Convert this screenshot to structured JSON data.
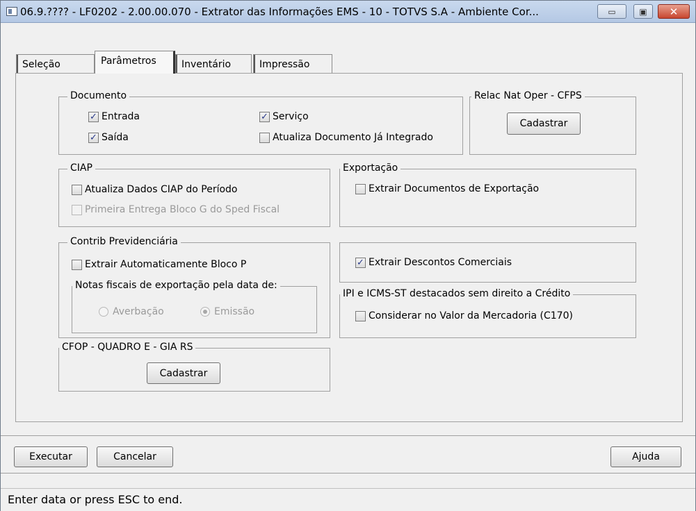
{
  "window": {
    "title": "06.9.???? - LF0202 - 2.00.00.070 - Extrator das Informações EMS - 10 - TOTVS S.A - Ambiente Cor...",
    "minimize": "▭",
    "maximize": "▣",
    "close": "✕"
  },
  "tabs": [
    {
      "label": "Seleção"
    },
    {
      "label": "Parâmetros"
    },
    {
      "label": "Inventário"
    },
    {
      "label": "Impressão"
    }
  ],
  "documento": {
    "legend": "Documento",
    "entrada": {
      "label": "Entrada",
      "checked": true
    },
    "saida": {
      "label": "Saída",
      "checked": true
    },
    "servico": {
      "label": "Serviço",
      "checked": true
    },
    "atualiza": {
      "label": "Atualiza Documento Já Integrado",
      "checked": false
    }
  },
  "relac": {
    "legend": "Relac Nat Oper - CFPS",
    "button": "Cadastrar"
  },
  "ciap": {
    "legend": "CIAP",
    "atualiza": {
      "label": "Atualiza Dados CIAP do Período",
      "checked": false
    },
    "primeira": {
      "label": "Primeira Entrega Bloco G do Sped Fiscal",
      "checked": false
    }
  },
  "exportacao": {
    "legend": "Exportação",
    "extrair": {
      "label": "Extrair Documentos de Exportação",
      "checked": false
    }
  },
  "contrib": {
    "legend": "Contrib Previdenciária",
    "extrair": {
      "label": "Extrair Automaticamente Bloco P",
      "checked": false
    },
    "notas_legend": "Notas fiscais de exportação pela data de:",
    "averbacao": "Averbação",
    "emissao": "Emissão"
  },
  "descontos": {
    "label": "Extrair Descontos Comerciais",
    "checked": true
  },
  "ipi": {
    "legend": "IPI e ICMS-ST destacados sem direito a Crédito",
    "considerar": {
      "label": "Considerar no Valor da Mercadoria (C170)",
      "checked": false
    }
  },
  "cfop": {
    "legend": "CFOP - QUADRO E - GIA RS",
    "button": "Cadastrar"
  },
  "actions": {
    "executar": "Executar",
    "cancelar": "Cancelar",
    "ajuda": "Ajuda"
  },
  "status": {
    "text": "Enter data or press ESC to end."
  },
  "check_glyph": "✓"
}
